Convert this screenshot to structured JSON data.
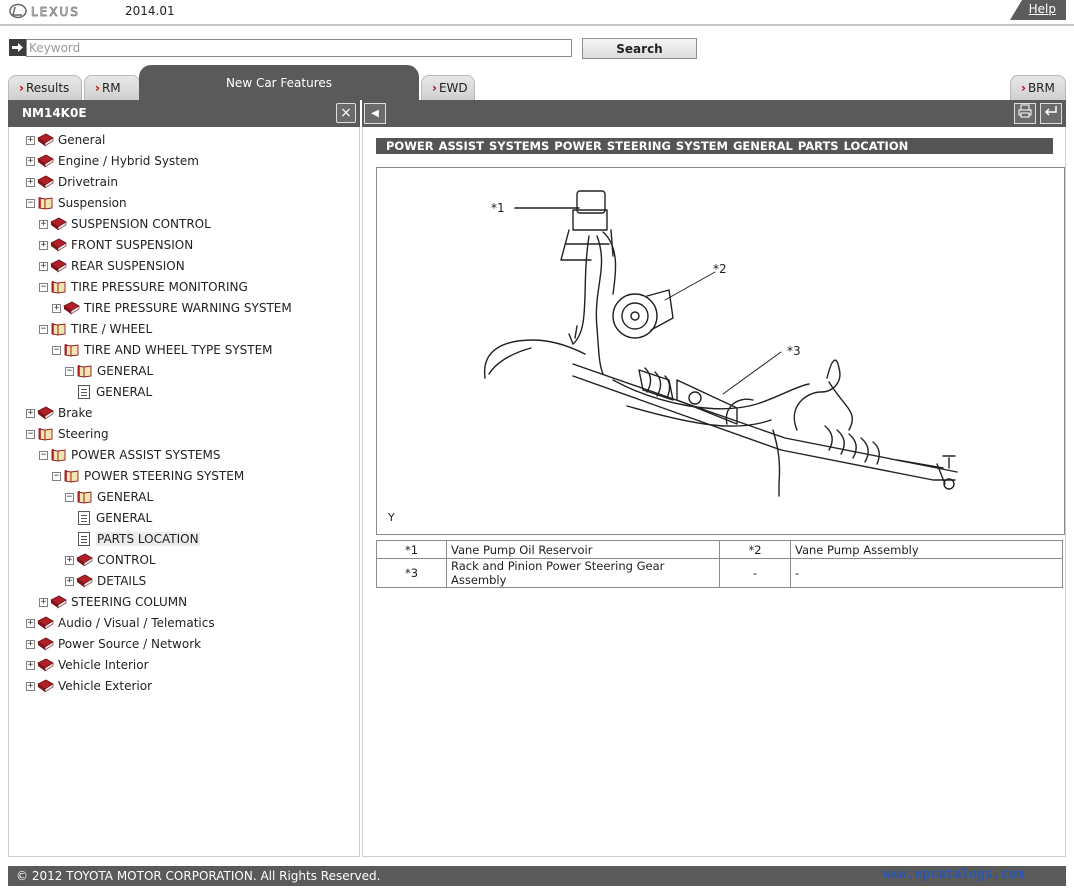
{
  "header": {
    "version": "2014.01",
    "help": "Help"
  },
  "search": {
    "placeholder": "Keyword",
    "button": "Search"
  },
  "tabs": {
    "results": "Results",
    "rm": "RM",
    "ncf": "New Car Features",
    "ewd": "EWD",
    "brm": "BRM"
  },
  "left": {
    "title": "NM14K0E",
    "close_icon": "×"
  },
  "tree": [
    {
      "label": "General",
      "depth": 0,
      "state": "+",
      "icon": "closed-book-icon"
    },
    {
      "label": "Engine / Hybrid System",
      "depth": 0,
      "state": "+",
      "icon": "closed-book-icon"
    },
    {
      "label": "Drivetrain",
      "depth": 0,
      "state": "+",
      "icon": "closed-book-icon"
    },
    {
      "label": "Suspension",
      "depth": 0,
      "state": "-",
      "icon": "open-book-icon"
    },
    {
      "label": "SUSPENSION CONTROL",
      "depth": 1,
      "state": "+",
      "icon": "closed-book-icon"
    },
    {
      "label": "FRONT SUSPENSION",
      "depth": 1,
      "state": "+",
      "icon": "closed-book-icon"
    },
    {
      "label": "REAR SUSPENSION",
      "depth": 1,
      "state": "+",
      "icon": "closed-book-icon"
    },
    {
      "label": "TIRE PRESSURE MONITORING",
      "depth": 1,
      "state": "-",
      "icon": "open-book-icon"
    },
    {
      "label": "TIRE PRESSURE WARNING SYSTEM",
      "depth": 2,
      "state": "+",
      "icon": "closed-book-icon"
    },
    {
      "label": "TIRE / WHEEL",
      "depth": 1,
      "state": "-",
      "icon": "open-book-icon"
    },
    {
      "label": "TIRE AND WHEEL TYPE SYSTEM",
      "depth": 2,
      "state": "-",
      "icon": "open-book-icon"
    },
    {
      "label": "GENERAL",
      "depth": 3,
      "state": "-",
      "icon": "open-book-icon"
    },
    {
      "label": "GENERAL",
      "depth": 3,
      "state": "",
      "icon": "page-icon"
    },
    {
      "label": "Brake",
      "depth": 0,
      "state": "+",
      "icon": "closed-book-icon"
    },
    {
      "label": "Steering",
      "depth": 0,
      "state": "-",
      "icon": "open-book-icon"
    },
    {
      "label": "POWER ASSIST SYSTEMS",
      "depth": 1,
      "state": "-",
      "icon": "open-book-icon"
    },
    {
      "label": "POWER STEERING SYSTEM",
      "depth": 2,
      "state": "-",
      "icon": "open-book-icon"
    },
    {
      "label": "GENERAL",
      "depth": 3,
      "state": "-",
      "icon": "open-book-icon"
    },
    {
      "label": "GENERAL",
      "depth": 3,
      "state": "",
      "icon": "page-icon"
    },
    {
      "label": "PARTS LOCATION",
      "depth": 3,
      "state": "",
      "icon": "page-icon",
      "selected": true
    },
    {
      "label": "CONTROL",
      "depth": 3,
      "state": "+",
      "icon": "closed-book-icon"
    },
    {
      "label": "DETAILS",
      "depth": 3,
      "state": "+",
      "icon": "closed-book-icon"
    },
    {
      "label": "STEERING COLUMN",
      "depth": 1,
      "state": "+",
      "icon": "closed-book-icon"
    },
    {
      "label": "Audio / Visual / Telematics",
      "depth": 0,
      "state": "+",
      "icon": "closed-book-icon"
    },
    {
      "label": "Power Source / Network",
      "depth": 0,
      "state": "+",
      "icon": "closed-book-icon"
    },
    {
      "label": "Vehicle Interior",
      "depth": 0,
      "state": "+",
      "icon": "closed-book-icon"
    },
    {
      "label": "Vehicle Exterior",
      "depth": 0,
      "state": "+",
      "icon": "closed-book-icon"
    }
  ],
  "content": {
    "breadcrumb": "POWER ASSIST SYSTEMS  POWER STEERING SYSTEM  GENERAL  PARTS LOCATION",
    "figure": {
      "callout1": "*1",
      "callout2": "*2",
      "callout3": "*3",
      "code": "Y"
    },
    "legend": [
      [
        "*1",
        "Vane Pump Oil Reservoir",
        "*2",
        "Vane Pump Assembly"
      ],
      [
        "*3",
        "Rack and Pinion Power Steering Gear Assembly",
        "-",
        "-"
      ]
    ]
  },
  "footer": {
    "copyright": "© 2012 TOYOTA MOTOR CORPORATION. All Rights Reserved.",
    "watermark": "www.epcatalogs.com"
  },
  "colors": {
    "bar": "#5a5a5a",
    "book": "#9b1c22",
    "arrow": "#c00000",
    "watermark": "#2b57b0"
  }
}
